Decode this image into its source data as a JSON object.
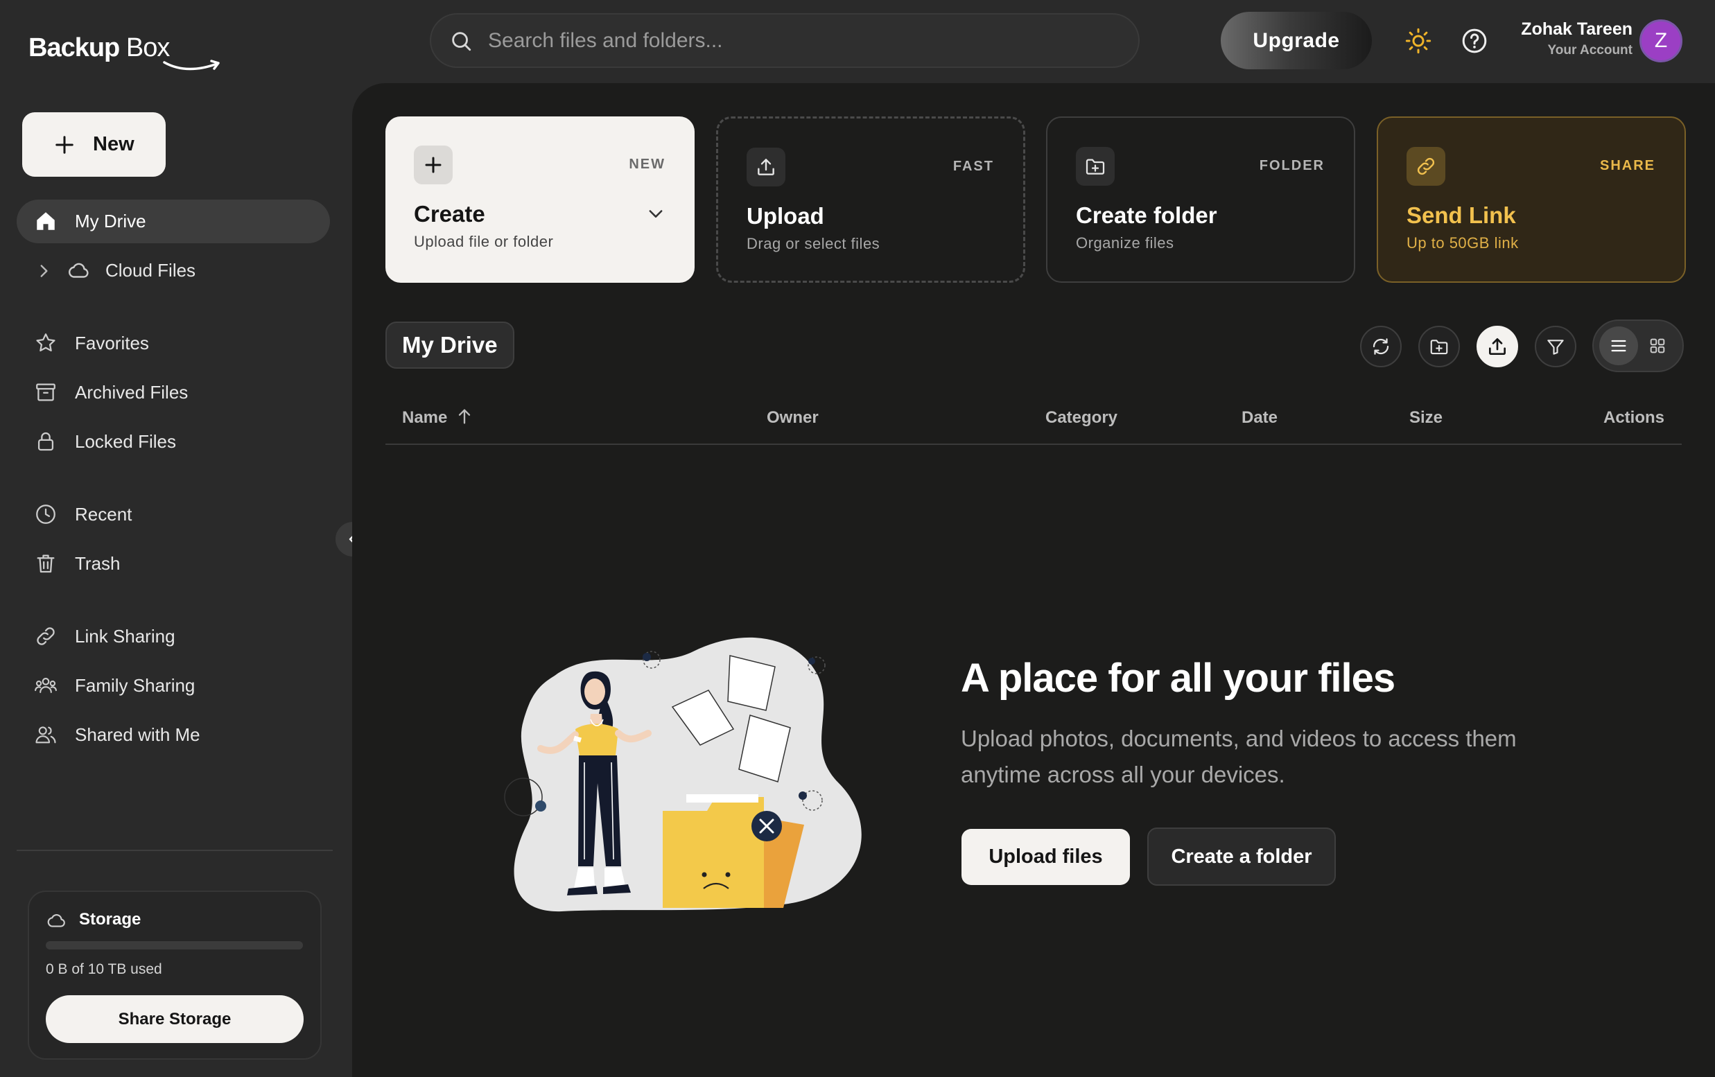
{
  "brand": {
    "name_bold": "Backup",
    "name_light": "Box"
  },
  "search": {
    "placeholder": "Search files and folders..."
  },
  "header": {
    "upgrade_label": "Upgrade",
    "theme_icon": "sun-icon",
    "help_icon": "help-icon",
    "user": {
      "name": "Zohak Tareen",
      "subtitle": "Your Account",
      "initial": "Z",
      "avatar_color": "#9b3fc4"
    }
  },
  "sidebar": {
    "new_label": "New",
    "items": [
      {
        "label": "My Drive",
        "icon": "home-icon",
        "active": true
      },
      {
        "label": "Cloud Files",
        "icon": "cloud-icon",
        "expandable": true
      },
      {
        "label": "Favorites",
        "icon": "star-icon"
      },
      {
        "label": "Archived Files",
        "icon": "archive-icon"
      },
      {
        "label": "Locked Files",
        "icon": "lock-icon"
      },
      {
        "label": "Recent",
        "icon": "clock-icon"
      },
      {
        "label": "Trash",
        "icon": "trash-icon"
      },
      {
        "label": "Link Sharing",
        "icon": "link-icon"
      },
      {
        "label": "Family Sharing",
        "icon": "family-icon"
      },
      {
        "label": "Shared with Me",
        "icon": "users-icon"
      }
    ],
    "storage": {
      "title": "Storage",
      "used_text": "0 B of 10 TB used",
      "used_fraction": 0,
      "share_label": "Share Storage"
    }
  },
  "quick_actions": [
    {
      "tag": "NEW",
      "title": "Create",
      "subtitle": "Upload file or folder",
      "icon": "plus-icon"
    },
    {
      "tag": "FAST",
      "title": "Upload",
      "subtitle": "Drag or select files",
      "icon": "upload-icon"
    },
    {
      "tag": "FOLDER",
      "title": "Create folder",
      "subtitle": "Organize files",
      "icon": "folder-plus-icon"
    },
    {
      "tag": "SHARE",
      "title": "Send Link",
      "subtitle": "Up to 50GB link",
      "icon": "link-icon",
      "accent": "#f2c14e"
    }
  ],
  "drive": {
    "title": "My Drive",
    "toolbar": [
      "refresh-icon",
      "folder-plus-icon",
      "upload-icon",
      "filter-icon"
    ],
    "view_mode": "list",
    "columns": [
      "Name",
      "Owner",
      "Category",
      "Date",
      "Size",
      "Actions"
    ],
    "sort": {
      "column": "Name",
      "direction": "asc"
    }
  },
  "empty_state": {
    "title": "A place for all your files",
    "description": "Upload photos, documents, and videos to access them anytime across all your devices.",
    "primary_label": "Upload files",
    "secondary_label": "Create a folder"
  }
}
